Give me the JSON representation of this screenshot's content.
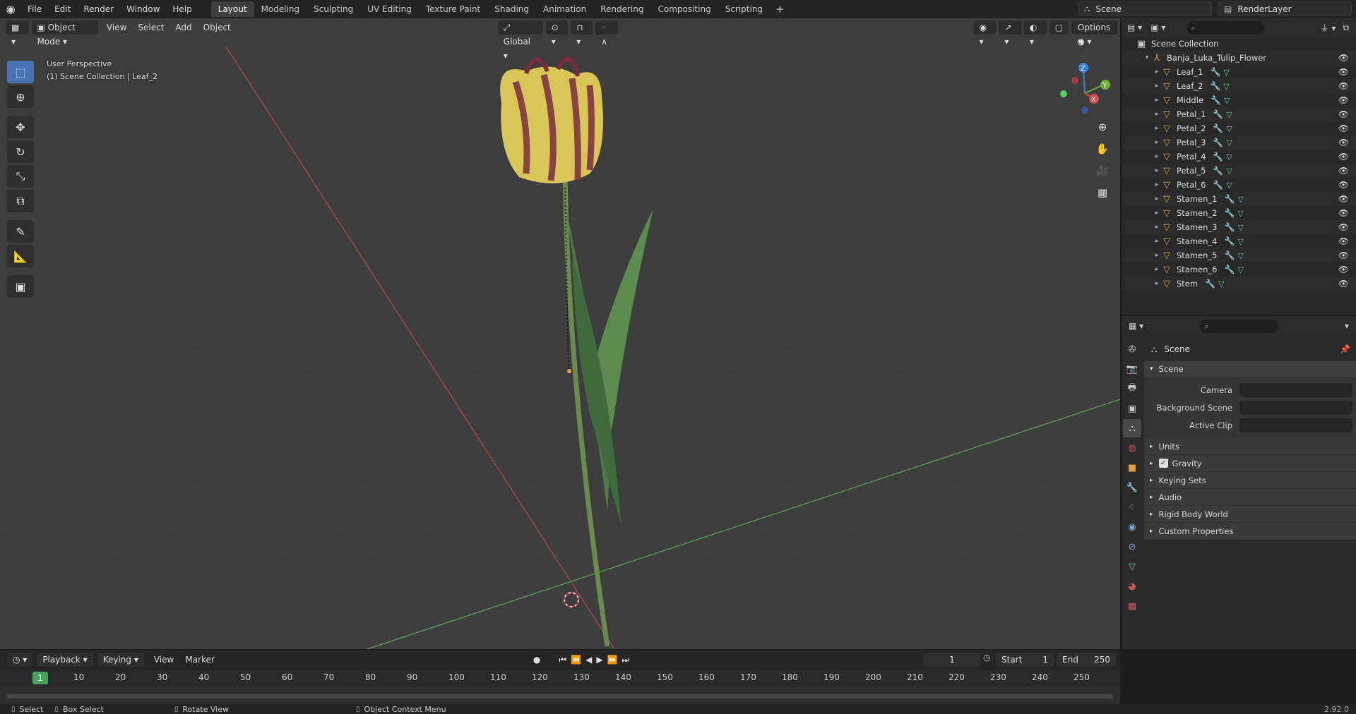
{
  "topbar": {
    "menus": [
      "File",
      "Edit",
      "Render",
      "Window",
      "Help"
    ],
    "workspaces": [
      "Layout",
      "Modeling",
      "Sculpting",
      "UV Editing",
      "Texture Paint",
      "Shading",
      "Animation",
      "Rendering",
      "Compositing",
      "Scripting"
    ],
    "active_workspace": "Layout",
    "scene": "Scene",
    "view_layer": "RenderLayer"
  },
  "viewport": {
    "mode": "Object Mode",
    "menus": [
      "View",
      "Select",
      "Add",
      "Object"
    ],
    "orientation": "Global",
    "options_label": "Options",
    "overlay_line1": "User Perspective",
    "overlay_line2": "(1) Scene Collection | Leaf_2",
    "gizmo_axes": {
      "x": "X",
      "y": "Y",
      "z": "Z"
    }
  },
  "outliner": {
    "root": "Scene Collection",
    "collection": "Banja_Luka_Tulip_Flower",
    "objects": [
      "Leaf_1",
      "Leaf_2",
      "Middle",
      "Petal_1",
      "Petal_2",
      "Petal_3",
      "Petal_4",
      "Petal_5",
      "Petal_6",
      "Stamen_1",
      "Stamen_2",
      "Stamen_3",
      "Stamen_4",
      "Stamen_5",
      "Stamen_6",
      "Stem"
    ]
  },
  "properties": {
    "breadcrumb": "Scene",
    "panel_title": "Scene",
    "fields": [
      {
        "label": "Camera",
        "value": ""
      },
      {
        "label": "Background Scene",
        "value": ""
      },
      {
        "label": "Active Clip",
        "value": ""
      }
    ],
    "subpanels": [
      "Units",
      "Gravity",
      "Keying Sets",
      "Audio",
      "Rigid Body World",
      "Custom Properties"
    ],
    "gravity_enabled": true
  },
  "timeline": {
    "menus": [
      "Playback",
      "Keying",
      "View",
      "Marker"
    ],
    "current_frame": "1",
    "start_label": "Start",
    "start": "1",
    "end_label": "End",
    "end": "250",
    "ticks": [
      "10",
      "20",
      "30",
      "40",
      "50",
      "60",
      "70",
      "80",
      "90",
      "100",
      "110",
      "120",
      "130",
      "140",
      "150",
      "160",
      "170",
      "180",
      "190",
      "200",
      "210",
      "220",
      "230",
      "240",
      "250"
    ]
  },
  "statusbar": {
    "items": [
      "Select",
      "Box Select",
      "Rotate View",
      "Object Context Menu"
    ],
    "version": "2.92.0"
  },
  "colors": {
    "accent": "#4772b3",
    "object_orange": "#e09e47",
    "frame_green": "#4aa159",
    "x_axis": "#b94747",
    "y_axis": "#55a352"
  }
}
